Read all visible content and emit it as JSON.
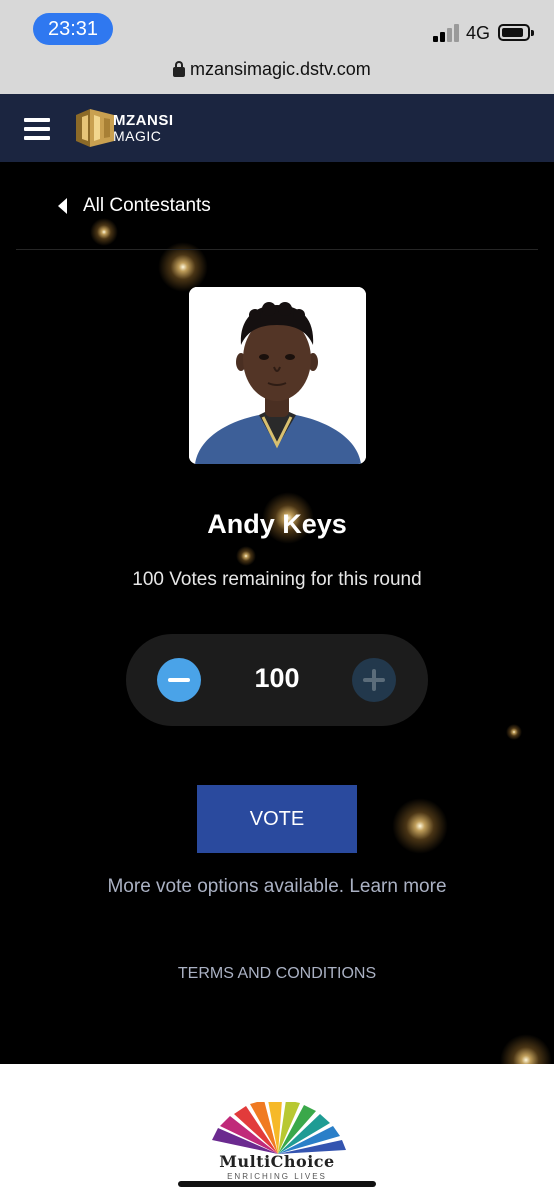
{
  "status_bar": {
    "time": "23:31",
    "network": "4G",
    "signal_bars": 4,
    "signal_bars_active": 2,
    "icons": [
      "signal-icon",
      "battery-icon"
    ]
  },
  "browser": {
    "url": "mzansimagic.dstv.com",
    "lock_icon": "lock-icon"
  },
  "header": {
    "menu_icon": "hamburger-icon",
    "logo_line1": "MZANSI",
    "logo_line2": "MAGIC",
    "header_color": "#1b2540",
    "logo_gold": "#b0893c"
  },
  "nav": {
    "back_label": "All Contestants",
    "back_icon": "chevron-left-icon"
  },
  "contestant": {
    "name": "Andy Keys",
    "votes_remaining_text": "100 Votes remaining for this round"
  },
  "stepper": {
    "value": "100",
    "minus_icon": "minus-icon",
    "plus_icon": "plus-icon",
    "minus_color": "#4aa3e8",
    "plus_color": "#22384c"
  },
  "vote": {
    "button_label": "VOTE",
    "button_color": "#2a4a9e",
    "more_options_text": "More vote options available. Learn more",
    "terms_label": "TERMS AND CONDITIONS"
  },
  "footer": {
    "brand": "MultiChoice",
    "tagline": "ENRICHING LIVES"
  }
}
